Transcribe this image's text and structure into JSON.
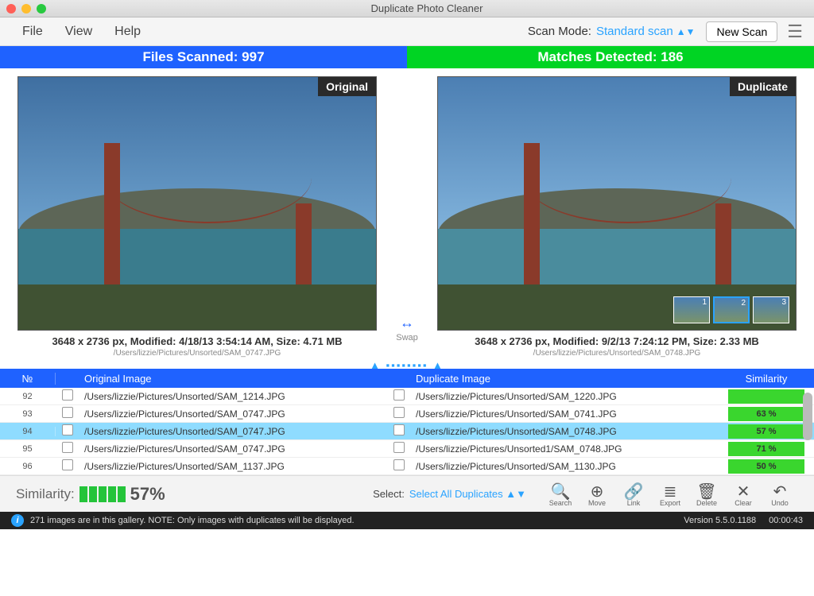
{
  "titlebar": {
    "title": "Duplicate Photo Cleaner"
  },
  "menu": {
    "file": "File",
    "view": "View",
    "help": "Help"
  },
  "scanMode": {
    "label": "Scan Mode:",
    "value": "Standard scan"
  },
  "newScan": "New Scan",
  "stats": {
    "left": "Files Scanned: 997",
    "right": "Matches Detected: 186"
  },
  "previews": {
    "original": {
      "badge": "Original",
      "meta": "3648 x 2736 px, Modified: 4/18/13 3:54:14 AM, Size: 4.71 MB",
      "path": "/Users/lizzie/Pictures/Unsorted/SAM_0747.JPG"
    },
    "duplicate": {
      "badge": "Duplicate",
      "meta": "3648 x 2736 px, Modified: 9/2/13 7:24:12 PM, Size: 2.33 MB",
      "path": "/Users/lizzie/Pictures/Unsorted/SAM_0748.JPG",
      "thumbs": [
        "1",
        "2",
        "3"
      ]
    },
    "swap": "Swap"
  },
  "table": {
    "headers": {
      "num": "№",
      "orig": "Original Image",
      "dup": "Duplicate Image",
      "sim": "Similarity"
    },
    "rows": [
      {
        "n": "92",
        "orig": "/Users/lizzie/Pictures/Unsorted/SAM_1214.JPG",
        "dup": "/Users/lizzie/Pictures/Unsorted/SAM_1220.JPG",
        "sim": "",
        "sel": false
      },
      {
        "n": "93",
        "orig": "/Users/lizzie/Pictures/Unsorted/SAM_0747.JPG",
        "dup": "/Users/lizzie/Pictures/Unsorted/SAM_0741.JPG",
        "sim": "63 %",
        "sel": false
      },
      {
        "n": "94",
        "orig": "/Users/lizzie/Pictures/Unsorted/SAM_0747.JPG",
        "dup": "/Users/lizzie/Pictures/Unsorted/SAM_0748.JPG",
        "sim": "57 %",
        "sel": true
      },
      {
        "n": "95",
        "orig": "/Users/lizzie/Pictures/Unsorted/SAM_0747.JPG",
        "dup": "/Users/lizzie/Pictures/Unsorted1/SAM_0748.JPG",
        "sim": "71 %",
        "sel": false
      },
      {
        "n": "96",
        "orig": "/Users/lizzie/Pictures/Unsorted/SAM_1137.JPG",
        "dup": "/Users/lizzie/Pictures/Unsorted/SAM_1130.JPG",
        "sim": "50 %",
        "sel": false
      }
    ]
  },
  "bottom": {
    "simLabel": "Similarity:",
    "simPct": "57%",
    "selectLabel": "Select:",
    "selectValue": "Select All Duplicates",
    "tools": [
      {
        "glyph": "🔍",
        "label": "Search"
      },
      {
        "glyph": "⊕",
        "label": "Move"
      },
      {
        "glyph": "🔗",
        "label": "Link"
      },
      {
        "glyph": "≣",
        "label": "Export"
      },
      {
        "glyph": "🗑",
        "label": "Delete"
      },
      {
        "glyph": "✕",
        "label": "Clear"
      },
      {
        "glyph": "↶",
        "label": "Undo"
      }
    ]
  },
  "status": {
    "info": "271 images are in this gallery. NOTE: Only images with duplicates will be displayed.",
    "version": "Version 5.5.0.1188",
    "time": "00:00:43"
  }
}
